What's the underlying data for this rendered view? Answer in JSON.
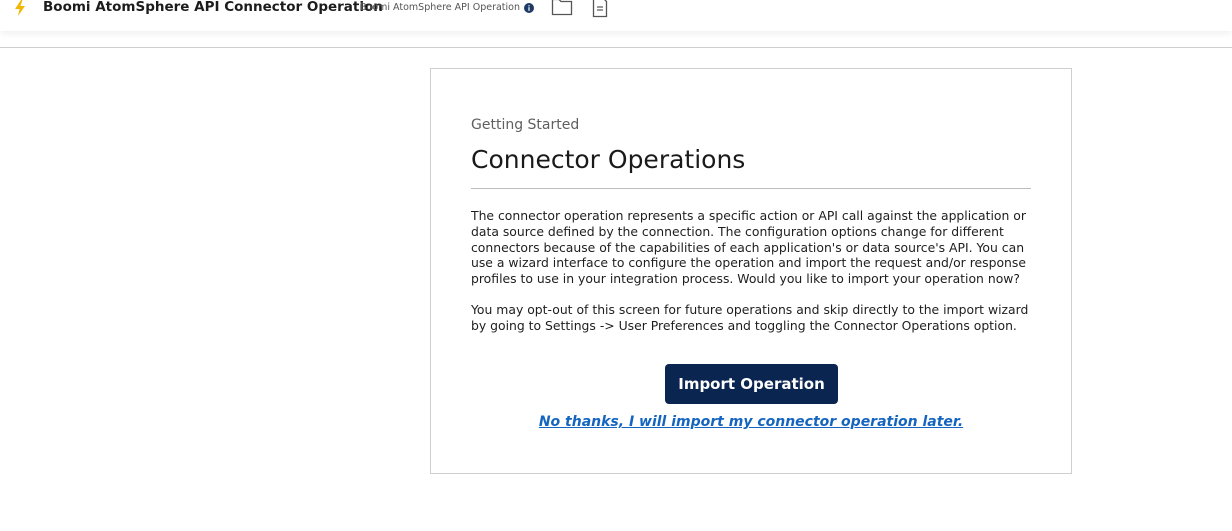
{
  "header": {
    "title": "Boomi AtomSphere API Connector Operation",
    "subtitle": "Boomi AtomSphere API Operation",
    "icons": [
      "bolt-icon",
      "info-icon",
      "folder-icon",
      "document-icon"
    ]
  },
  "card": {
    "eyebrow": "Getting Started",
    "heading": "Connector Operations",
    "paragraph1": "The connector operation represents a specific action or API call against the application or data source defined by the connection. The configuration options change for different connectors because of the capabilities of each application's or data source's API. You can use a wizard interface to configure the operation and import the request and/or response profiles to use in your integration process. Would you like to import your operation now?",
    "paragraph2": "You may opt-out of this screen for future operations and skip directly to the import wizard by going to Settings -> User Preferences and toggling the Connector Operations option.",
    "import_button": "Import Operation",
    "later_link": "No thanks, I will import my connector operation later."
  },
  "colors": {
    "primary_button": "#0b2551",
    "link": "#1565c0",
    "bolt": "#f2b705"
  }
}
